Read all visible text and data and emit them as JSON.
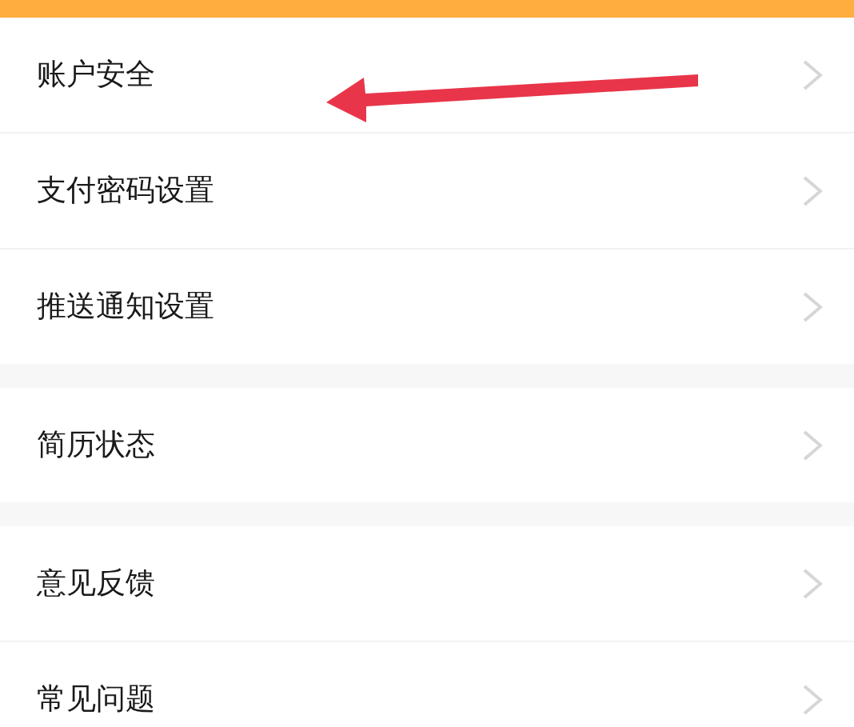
{
  "sections": [
    {
      "items": [
        {
          "label": "账户安全",
          "arrow_annotation": true
        },
        {
          "label": "支付密码设置",
          "arrow_annotation": false
        },
        {
          "label": "推送通知设置",
          "arrow_annotation": false
        }
      ]
    },
    {
      "items": [
        {
          "label": "简历状态",
          "arrow_annotation": false
        }
      ]
    },
    {
      "items": [
        {
          "label": "意见反馈",
          "arrow_annotation": false
        },
        {
          "label": "常见问题",
          "arrow_annotation": false
        }
      ]
    }
  ]
}
